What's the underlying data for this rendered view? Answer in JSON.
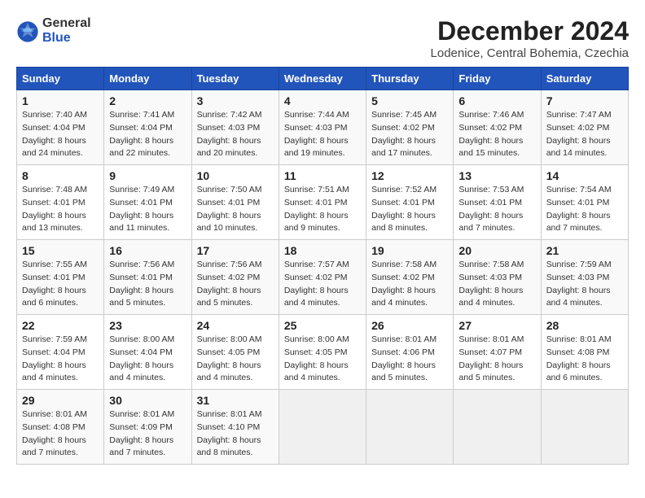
{
  "header": {
    "logo_general": "General",
    "logo_blue": "Blue",
    "title": "December 2024",
    "subtitle": "Lodenice, Central Bohemia, Czechia"
  },
  "columns": [
    "Sunday",
    "Monday",
    "Tuesday",
    "Wednesday",
    "Thursday",
    "Friday",
    "Saturday"
  ],
  "weeks": [
    [
      {
        "day": "1",
        "sunrise": "7:40 AM",
        "sunset": "4:04 PM",
        "daylight": "8 hours and 24 minutes."
      },
      {
        "day": "2",
        "sunrise": "7:41 AM",
        "sunset": "4:04 PM",
        "daylight": "8 hours and 22 minutes."
      },
      {
        "day": "3",
        "sunrise": "7:42 AM",
        "sunset": "4:03 PM",
        "daylight": "8 hours and 20 minutes."
      },
      {
        "day": "4",
        "sunrise": "7:44 AM",
        "sunset": "4:03 PM",
        "daylight": "8 hours and 19 minutes."
      },
      {
        "day": "5",
        "sunrise": "7:45 AM",
        "sunset": "4:02 PM",
        "daylight": "8 hours and 17 minutes."
      },
      {
        "day": "6",
        "sunrise": "7:46 AM",
        "sunset": "4:02 PM",
        "daylight": "8 hours and 15 minutes."
      },
      {
        "day": "7",
        "sunrise": "7:47 AM",
        "sunset": "4:02 PM",
        "daylight": "8 hours and 14 minutes."
      }
    ],
    [
      {
        "day": "8",
        "sunrise": "7:48 AM",
        "sunset": "4:01 PM",
        "daylight": "8 hours and 13 minutes."
      },
      {
        "day": "9",
        "sunrise": "7:49 AM",
        "sunset": "4:01 PM",
        "daylight": "8 hours and 11 minutes."
      },
      {
        "day": "10",
        "sunrise": "7:50 AM",
        "sunset": "4:01 PM",
        "daylight": "8 hours and 10 minutes."
      },
      {
        "day": "11",
        "sunrise": "7:51 AM",
        "sunset": "4:01 PM",
        "daylight": "8 hours and 9 minutes."
      },
      {
        "day": "12",
        "sunrise": "7:52 AM",
        "sunset": "4:01 PM",
        "daylight": "8 hours and 8 minutes."
      },
      {
        "day": "13",
        "sunrise": "7:53 AM",
        "sunset": "4:01 PM",
        "daylight": "8 hours and 7 minutes."
      },
      {
        "day": "14",
        "sunrise": "7:54 AM",
        "sunset": "4:01 PM",
        "daylight": "8 hours and 7 minutes."
      }
    ],
    [
      {
        "day": "15",
        "sunrise": "7:55 AM",
        "sunset": "4:01 PM",
        "daylight": "8 hours and 6 minutes."
      },
      {
        "day": "16",
        "sunrise": "7:56 AM",
        "sunset": "4:01 PM",
        "daylight": "8 hours and 5 minutes."
      },
      {
        "day": "17",
        "sunrise": "7:56 AM",
        "sunset": "4:02 PM",
        "daylight": "8 hours and 5 minutes."
      },
      {
        "day": "18",
        "sunrise": "7:57 AM",
        "sunset": "4:02 PM",
        "daylight": "8 hours and 4 minutes."
      },
      {
        "day": "19",
        "sunrise": "7:58 AM",
        "sunset": "4:02 PM",
        "daylight": "8 hours and 4 minutes."
      },
      {
        "day": "20",
        "sunrise": "7:58 AM",
        "sunset": "4:03 PM",
        "daylight": "8 hours and 4 minutes."
      },
      {
        "day": "21",
        "sunrise": "7:59 AM",
        "sunset": "4:03 PM",
        "daylight": "8 hours and 4 minutes."
      }
    ],
    [
      {
        "day": "22",
        "sunrise": "7:59 AM",
        "sunset": "4:04 PM",
        "daylight": "8 hours and 4 minutes."
      },
      {
        "day": "23",
        "sunrise": "8:00 AM",
        "sunset": "4:04 PM",
        "daylight": "8 hours and 4 minutes."
      },
      {
        "day": "24",
        "sunrise": "8:00 AM",
        "sunset": "4:05 PM",
        "daylight": "8 hours and 4 minutes."
      },
      {
        "day": "25",
        "sunrise": "8:00 AM",
        "sunset": "4:05 PM",
        "daylight": "8 hours and 4 minutes."
      },
      {
        "day": "26",
        "sunrise": "8:01 AM",
        "sunset": "4:06 PM",
        "daylight": "8 hours and 5 minutes."
      },
      {
        "day": "27",
        "sunrise": "8:01 AM",
        "sunset": "4:07 PM",
        "daylight": "8 hours and 5 minutes."
      },
      {
        "day": "28",
        "sunrise": "8:01 AM",
        "sunset": "4:08 PM",
        "daylight": "8 hours and 6 minutes."
      }
    ],
    [
      {
        "day": "29",
        "sunrise": "8:01 AM",
        "sunset": "4:08 PM",
        "daylight": "8 hours and 7 minutes."
      },
      {
        "day": "30",
        "sunrise": "8:01 AM",
        "sunset": "4:09 PM",
        "daylight": "8 hours and 7 minutes."
      },
      {
        "day": "31",
        "sunrise": "8:01 AM",
        "sunset": "4:10 PM",
        "daylight": "8 hours and 8 minutes."
      },
      null,
      null,
      null,
      null
    ]
  ],
  "labels": {
    "sunrise": "Sunrise:",
    "sunset": "Sunset:",
    "daylight": "Daylight:"
  }
}
